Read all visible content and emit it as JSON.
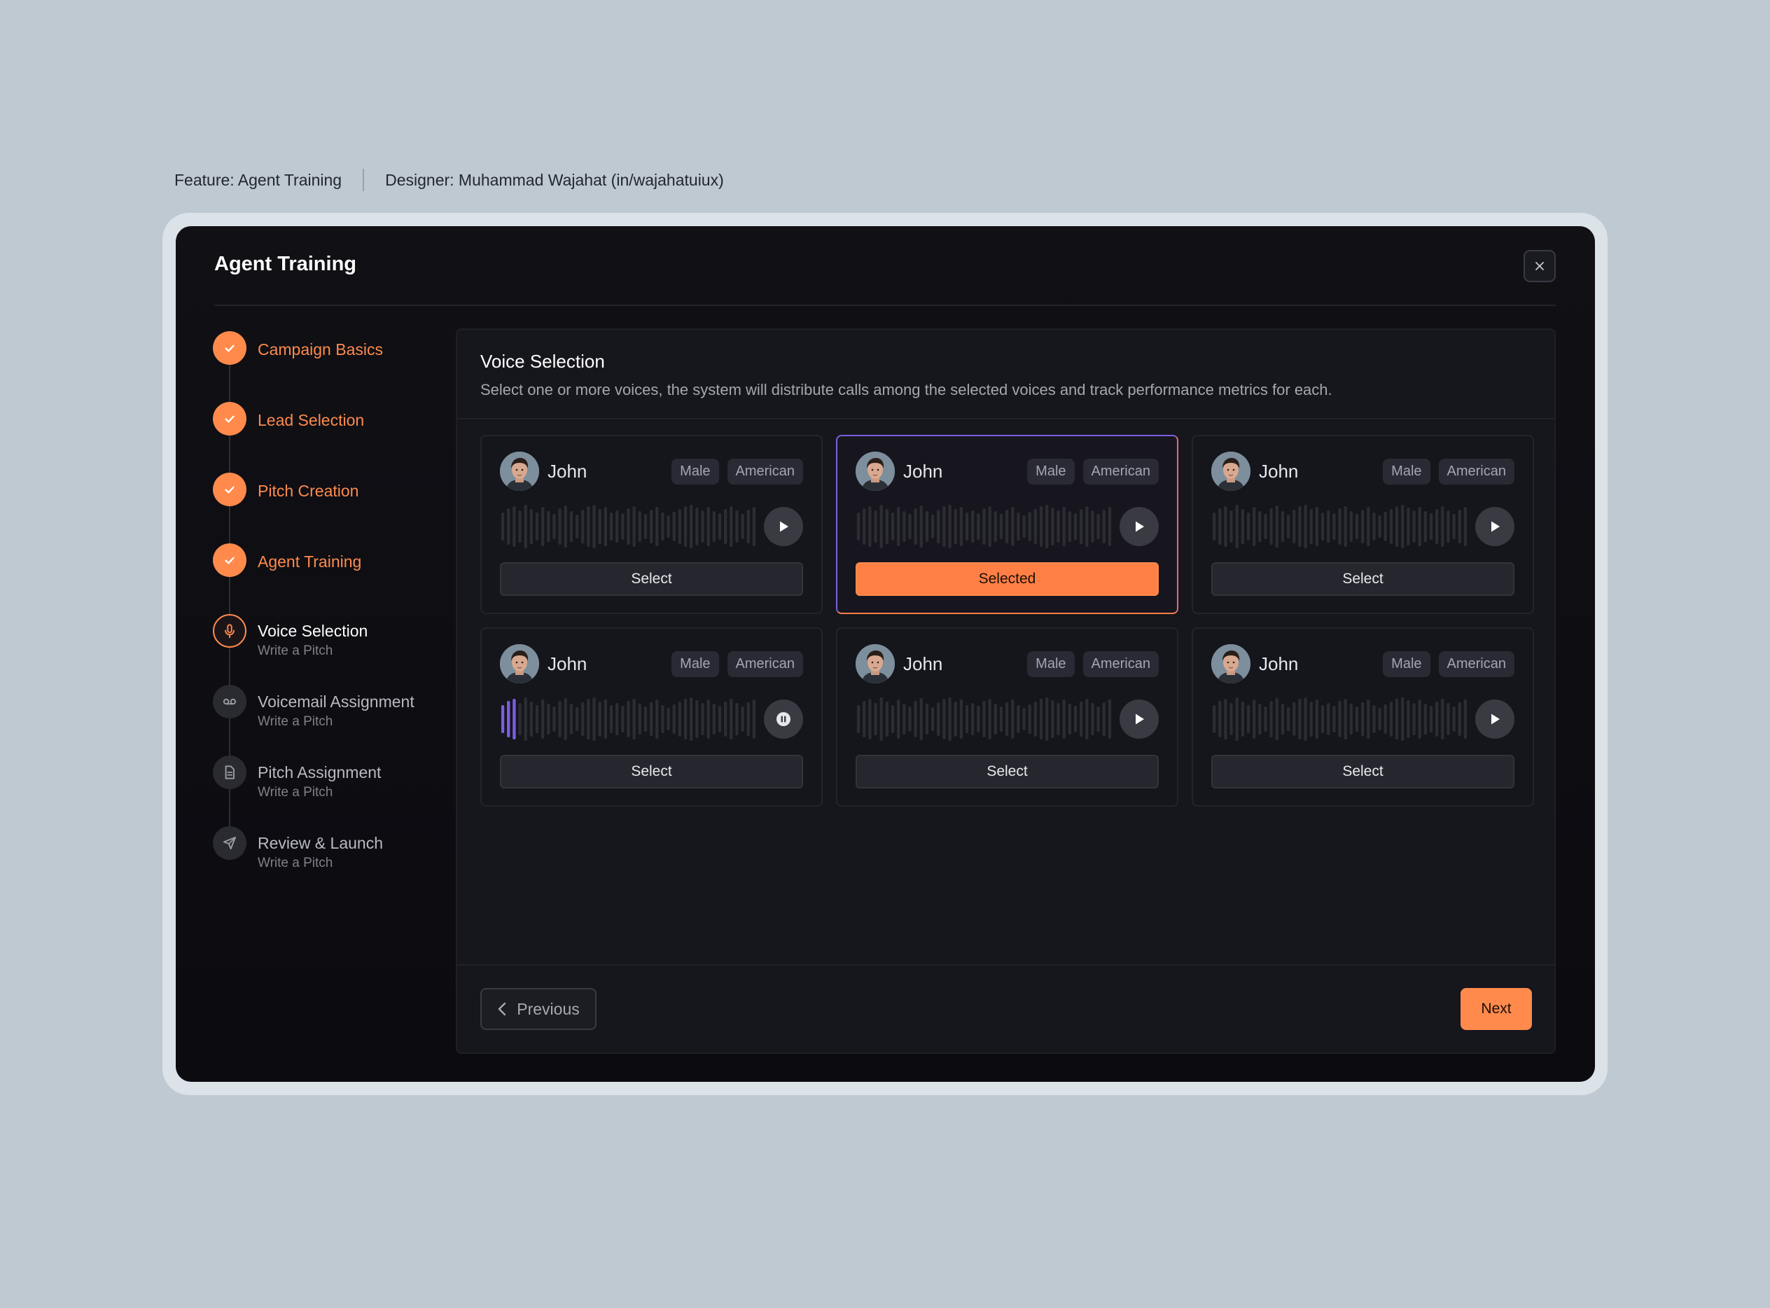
{
  "meta": {
    "feature": "Feature: Agent Training",
    "designer": "Designer: Muhammad Wajahat (in/wajahatuiux)"
  },
  "modal": {
    "title": "Agent Training",
    "close_icon": "close-icon"
  },
  "steps": [
    {
      "title": "Campaign Basics",
      "subtitle": "",
      "state": "done",
      "icon": "check-icon"
    },
    {
      "title": "Lead Selection",
      "subtitle": "",
      "state": "done",
      "icon": "check-icon"
    },
    {
      "title": "Pitch Creation",
      "subtitle": "",
      "state": "done",
      "icon": "check-icon"
    },
    {
      "title": "Agent Training",
      "subtitle": "",
      "state": "done",
      "icon": "check-icon"
    },
    {
      "title": "Voice Selection",
      "subtitle": "Write a Pitch",
      "state": "current",
      "icon": "microphone-icon"
    },
    {
      "title": "Voicemail Assignment",
      "subtitle": "Write a Pitch",
      "state": "upcoming",
      "icon": "voicemail-icon"
    },
    {
      "title": "Pitch Assignment",
      "subtitle": "Write a Pitch",
      "state": "upcoming",
      "icon": "document-icon"
    },
    {
      "title": "Review & Launch",
      "subtitle": "Write a Pitch",
      "state": "upcoming",
      "icon": "send-icon"
    }
  ],
  "panel": {
    "title": "Voice Selection",
    "description": "Select one or more voices, the system will distribute calls among the selected voices and track performance metrics for each."
  },
  "voices": [
    {
      "name": "John",
      "gender": "Male",
      "accent": "American",
      "button": "Select",
      "selected": false,
      "playing": false,
      "progress": 0
    },
    {
      "name": "John",
      "gender": "Male",
      "accent": "American",
      "button": "Selected",
      "selected": true,
      "playing": false,
      "progress": 0
    },
    {
      "name": "John",
      "gender": "Male",
      "accent": "American",
      "button": "Select",
      "selected": false,
      "playing": false,
      "progress": 0
    },
    {
      "name": "John",
      "gender": "Male",
      "accent": "American",
      "button": "Select",
      "selected": false,
      "playing": true,
      "progress": 0.07
    },
    {
      "name": "John",
      "gender": "Male",
      "accent": "American",
      "button": "Select",
      "selected": false,
      "playing": false,
      "progress": 0
    },
    {
      "name": "John",
      "gender": "Male",
      "accent": "American",
      "button": "Select",
      "selected": false,
      "playing": false,
      "progress": 0
    }
  ],
  "footer": {
    "previous_label": "Previous",
    "next_label": "Next"
  },
  "colors": {
    "accent": "#ff8a4c",
    "wave_played": "#7c5fe0",
    "wave_idle": "#2c2c33"
  }
}
